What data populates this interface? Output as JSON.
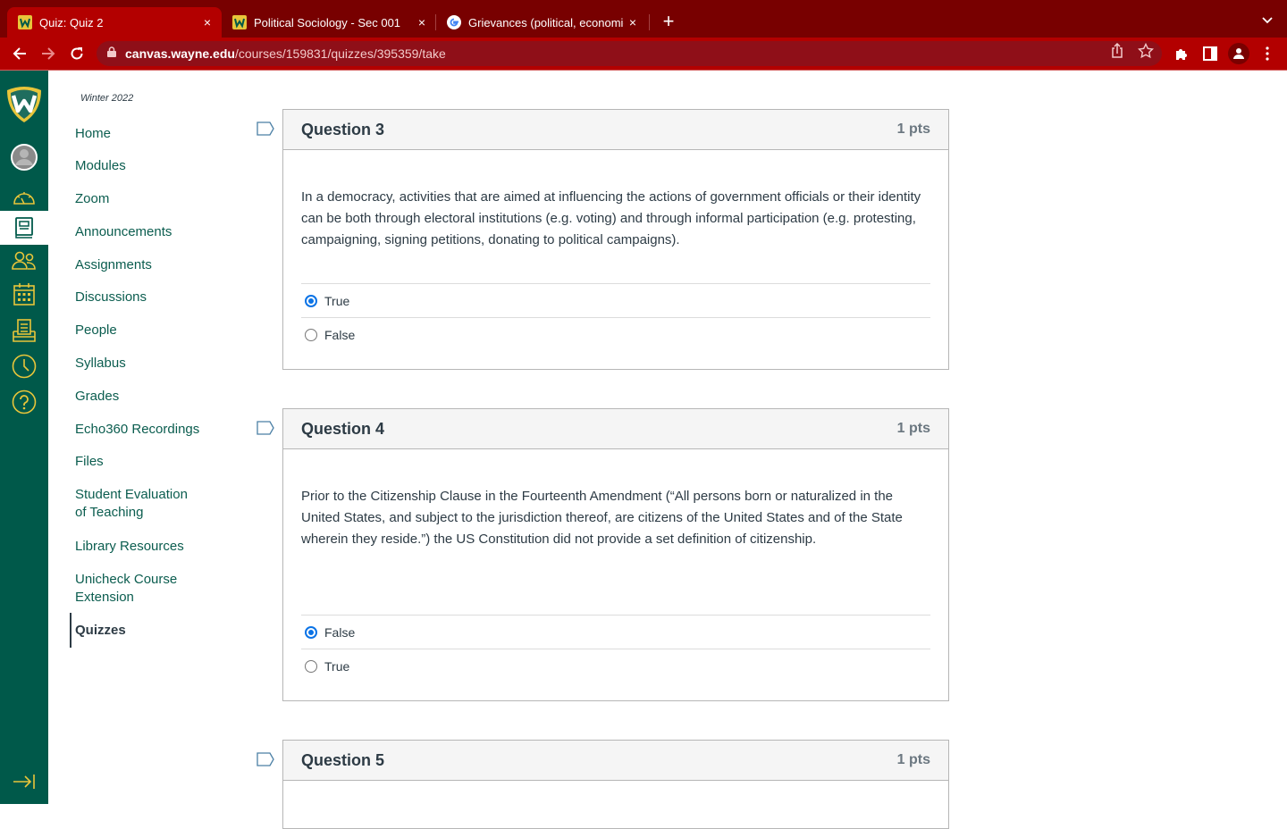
{
  "browser": {
    "tabs": [
      {
        "title": "Quiz: Quiz 2",
        "favicon": "wayne-state-icon",
        "active": true
      },
      {
        "title": "Political Sociology - Sec 001",
        "favicon": "wayne-state-icon",
        "active": false
      },
      {
        "title": "Grievances (political, economic",
        "favicon": "google-icon",
        "active": false
      }
    ],
    "close_glyph": "×",
    "new_tab_glyph": "+",
    "url_host": "canvas.wayne.edu",
    "url_path": "/courses/159831/quizzes/395359/take"
  },
  "global_nav": {
    "items": [
      "wayne-state-logo",
      "account",
      "dashboard",
      "courses",
      "groups",
      "calendar",
      "inbox",
      "history",
      "help"
    ],
    "active": "courses",
    "collapse": "collapse-nav"
  },
  "course_nav": {
    "term": "Winter 2022",
    "items": [
      {
        "label": "Home"
      },
      {
        "label": "Modules"
      },
      {
        "label": "Zoom"
      },
      {
        "label": "Announcements"
      },
      {
        "label": "Assignments"
      },
      {
        "label": "Discussions"
      },
      {
        "label": "People"
      },
      {
        "label": "Syllabus"
      },
      {
        "label": "Grades"
      },
      {
        "label": "Echo360 Recordings"
      },
      {
        "label": "Files"
      },
      {
        "label": "Student Evaluation of Teaching",
        "line1": "Student Evaluation",
        "line2": "of Teaching"
      },
      {
        "label": "Library Resources"
      },
      {
        "label": "Unicheck Course Extension",
        "line1": "Unicheck Course",
        "line2": "Extension"
      },
      {
        "label": "Quizzes",
        "active": true
      }
    ]
  },
  "questions": [
    {
      "title": "Question 3",
      "points": "1 pts",
      "text": "In a democracy, activities that are aimed at influencing the actions of government officials or their identity can be both through electoral institutions (e.g. voting) and through informal participation (e.g. protesting, campaigning, signing petitions, donating to political campaigns).",
      "answers": [
        {
          "label": "True",
          "selected": true
        },
        {
          "label": "False",
          "selected": false
        }
      ]
    },
    {
      "title": "Question 4",
      "points": "1 pts",
      "text": "Prior to the Citizenship Clause in the Fourteenth Amendment (“All persons born or naturalized in the United States, and subject to the jurisdiction thereof, are citizens of the United States and of the State wherein they reside.”) the US Constitution did not provide a set definition of citizenship.",
      "answers": [
        {
          "label": "False",
          "selected": true
        },
        {
          "label": "True",
          "selected": false
        }
      ]
    },
    {
      "title": "Question 5",
      "points": "1 pts"
    }
  ],
  "colors": {
    "chrome_dark": "#780000",
    "chrome_tab": "#b30000",
    "canvas_nav": "#00594a",
    "nav_icon": "#e8c53a",
    "link": "#0b5d4f",
    "radio_selected": "#0b73e6"
  }
}
